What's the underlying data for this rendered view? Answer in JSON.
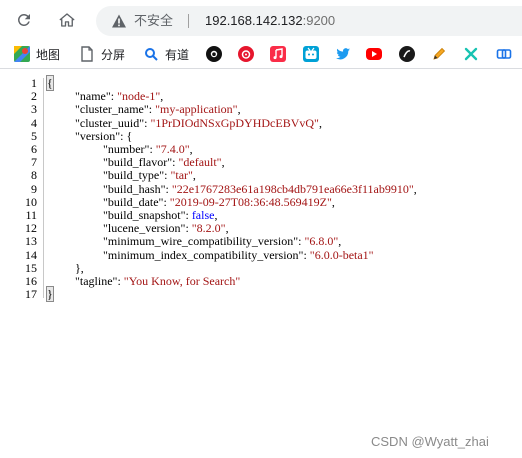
{
  "toolbar": {
    "security_label": "不安全",
    "url_host": "192.168.142.132",
    "url_port": ":9200"
  },
  "bookmarks": [
    {
      "label": "地图",
      "icon": "maps-icon"
    },
    {
      "label": "分屏",
      "icon": "document-icon"
    },
    {
      "label": "有道",
      "icon": "search-icon"
    },
    {
      "label": "",
      "icon": "github-icon"
    },
    {
      "label": "",
      "icon": "weibo-icon"
    },
    {
      "label": "",
      "icon": "music-icon"
    },
    {
      "label": "",
      "icon": "bilibili-icon"
    },
    {
      "label": "",
      "icon": "twitter-icon"
    },
    {
      "label": "",
      "icon": "youtube-icon"
    },
    {
      "label": "",
      "icon": "zhihu-icon"
    },
    {
      "label": "",
      "icon": "pencil-icon"
    },
    {
      "label": "",
      "icon": "cross-icon"
    },
    {
      "label": "",
      "icon": "link-icon"
    }
  ],
  "json_view": {
    "lines": [
      {
        "n": "1",
        "indent": 0,
        "text": "{"
      },
      {
        "n": "2",
        "indent": 1,
        "key": "\"name\"",
        "value": "\"node-1\"",
        "vtype": "s",
        "tail": ","
      },
      {
        "n": "3",
        "indent": 1,
        "key": "\"cluster_name\"",
        "value": "\"my-application\"",
        "vtype": "s",
        "tail": ","
      },
      {
        "n": "4",
        "indent": 1,
        "key": "\"cluster_uuid\"",
        "value": "\"1PrDIOdNSxGpDYHDcEBVvQ\"",
        "vtype": "s",
        "tail": ","
      },
      {
        "n": "5",
        "indent": 1,
        "key": "\"version\"",
        "value": "{",
        "vtype": "k",
        "tail": ""
      },
      {
        "n": "6",
        "indent": 2,
        "key": "\"number\"",
        "value": "\"7.4.0\"",
        "vtype": "s",
        "tail": ","
      },
      {
        "n": "7",
        "indent": 2,
        "key": "\"build_flavor\"",
        "value": "\"default\"",
        "vtype": "s",
        "tail": ","
      },
      {
        "n": "8",
        "indent": 2,
        "key": "\"build_type\"",
        "value": "\"tar\"",
        "vtype": "s",
        "tail": ","
      },
      {
        "n": "9",
        "indent": 2,
        "key": "\"build_hash\"",
        "value": "\"22e1767283e61a198cb4db791ea66e3f11ab9910\"",
        "vtype": "s",
        "tail": ","
      },
      {
        "n": "10",
        "indent": 2,
        "key": "\"build_date\"",
        "value": "\"2019-09-27T08:36:48.569419Z\"",
        "vtype": "s",
        "tail": ","
      },
      {
        "n": "11",
        "indent": 2,
        "key": "\"build_snapshot\"",
        "value": "false",
        "vtype": "b",
        "tail": ","
      },
      {
        "n": "12",
        "indent": 2,
        "key": "\"lucene_version\"",
        "value": "\"8.2.0\"",
        "vtype": "s",
        "tail": ","
      },
      {
        "n": "13",
        "indent": 2,
        "key": "\"minimum_wire_compatibility_version\"",
        "value": "\"6.8.0\"",
        "vtype": "s",
        "tail": ","
      },
      {
        "n": "14",
        "indent": 2,
        "key": "\"minimum_index_compatibility_version\"",
        "value": "\"6.0.0-beta1\"",
        "vtype": "s",
        "tail": ""
      },
      {
        "n": "15",
        "indent": 1,
        "text": "},"
      },
      {
        "n": "16",
        "indent": 1,
        "key": "\"tagline\"",
        "value": "\"You Know, for Search\"",
        "vtype": "s",
        "tail": ""
      },
      {
        "n": "17",
        "indent": 0,
        "text": "}"
      }
    ]
  },
  "watermark": "CSDN @Wyatt_zhai"
}
